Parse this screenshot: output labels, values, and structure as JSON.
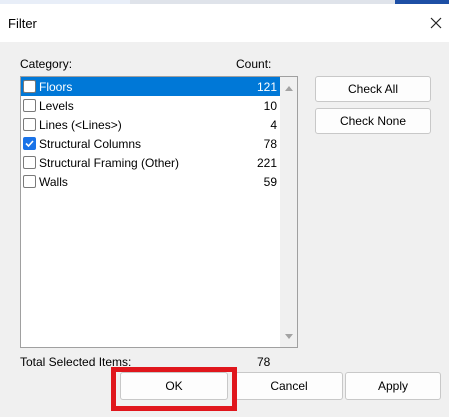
{
  "dialog": {
    "title": "Filter"
  },
  "columns": {
    "category": "Category:",
    "count": "Count:"
  },
  "rows": [
    {
      "label": "Floors",
      "count": "121",
      "checked": false,
      "selected": true
    },
    {
      "label": "Levels",
      "count": "10",
      "checked": false,
      "selected": false
    },
    {
      "label": "Lines (<Lines>)",
      "count": "4",
      "checked": false,
      "selected": false
    },
    {
      "label": "Structural Columns",
      "count": "78",
      "checked": true,
      "selected": false
    },
    {
      "label": "Structural Framing (Other)",
      "count": "221",
      "checked": false,
      "selected": false
    },
    {
      "label": "Walls",
      "count": "59",
      "checked": false,
      "selected": false
    }
  ],
  "buttons": {
    "check_all": "Check All",
    "check_none": "Check None",
    "ok": "OK",
    "cancel": "Cancel",
    "apply": "Apply"
  },
  "total": {
    "label": "Total Selected Items:",
    "value": "78"
  },
  "colors": {
    "selection": "#0078d7",
    "highlight": "#e0161c",
    "checkbox_checked": "#1a73e8"
  }
}
